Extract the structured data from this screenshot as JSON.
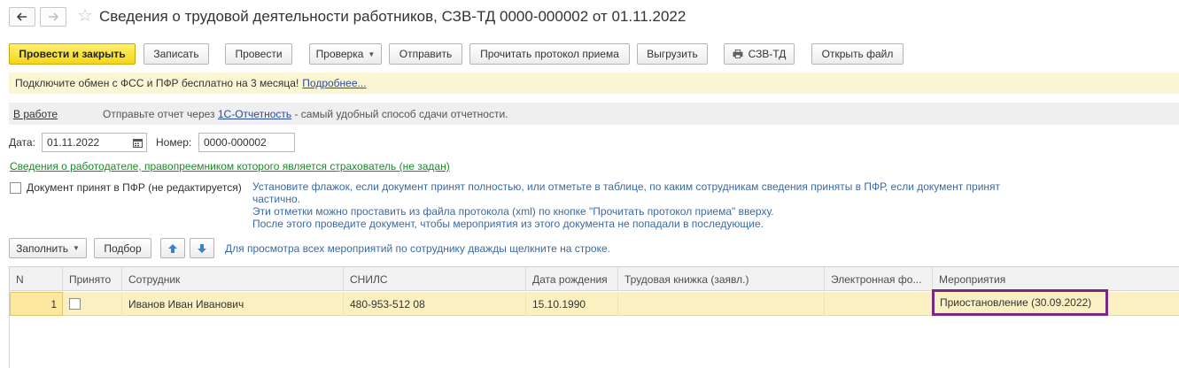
{
  "window": {
    "title": "Сведения о трудовой деятельности работников, СЗВ-ТД 0000-000002 от 01.11.2022",
    "back_icon": "arrow-left-icon",
    "forward_icon": "arrow-right-icon",
    "favorite_icon": "star-icon"
  },
  "toolbar": {
    "post_and_close": "Провести и закрыть",
    "save": "Записать",
    "post": "Провести",
    "check": "Проверка",
    "send": "Отправить",
    "read_protocol": "Прочитать протокол приема",
    "export": "Выгрузить",
    "print_szv": "СЗВ-ТД",
    "open_file": "Открыть файл"
  },
  "infobar": {
    "text": "Подключите обмен с ФСС и ПФР бесплатно на 3 месяца!",
    "link": "Подробнее..."
  },
  "statusbar": {
    "state": "В работе",
    "hint_prefix": "Отправьте отчет через",
    "hint_link": "1С-Отчетность",
    "hint_suffix": "- самый удобный способ сдачи отчетности."
  },
  "form": {
    "date_label": "Дата:",
    "date_value": "01.11.2022",
    "number_label": "Номер:",
    "number_value": "0000-000002",
    "employer_link": "Сведения о работодателе, правопреемником которого является страхователь (не задан)",
    "accepted_checkbox_label": "Документ принят в ПФР (не редактируется)",
    "accepted_checked": false,
    "note_line1": "Установите флажок, если документ принят полностью, или отметьте в таблице, по каким сотрудникам сведения приняты в ПФР, если документ принят частично.",
    "note_line2": "Эти отметки можно проставить из файла протокола (xml) по кнопке \"Прочитать протокол приема\" вверху.",
    "note_line3": "После этого проведите документ, чтобы мероприятия из этого документа не попадали в последующие."
  },
  "table_toolbar": {
    "fill": "Заполнить",
    "select": "Подбор",
    "up_icon": "arrow-up-icon",
    "down_icon": "arrow-down-icon",
    "hint": "Для просмотра всех мероприятий по сотруднику дважды щелкните на строке."
  },
  "table": {
    "columns": {
      "n": "N",
      "accepted": "Принято",
      "employee": "Сотрудник",
      "snils": "СНИЛС",
      "birth_date": "Дата рождения",
      "work_book": "Трудовая книжка (заявл.)",
      "electronic": "Электронная фо...",
      "events": "Мероприятия"
    },
    "rows": [
      {
        "n": "1",
        "accepted": false,
        "employee": "Иванов Иван Иванович",
        "snils": "480-953-512 08",
        "birth_date": "15.10.1990",
        "work_book": "",
        "electronic": "",
        "events": "Приостановление (30.09.2022)"
      }
    ]
  },
  "colors": {
    "primary_button": "#f3d619",
    "infobar": "#fbf7d5",
    "link": "#284b9e",
    "green_link": "#1b8a2a",
    "note_text": "#3c6aa0",
    "selected_row": "#fbf0c2",
    "highlight_border": "#7b2585"
  }
}
